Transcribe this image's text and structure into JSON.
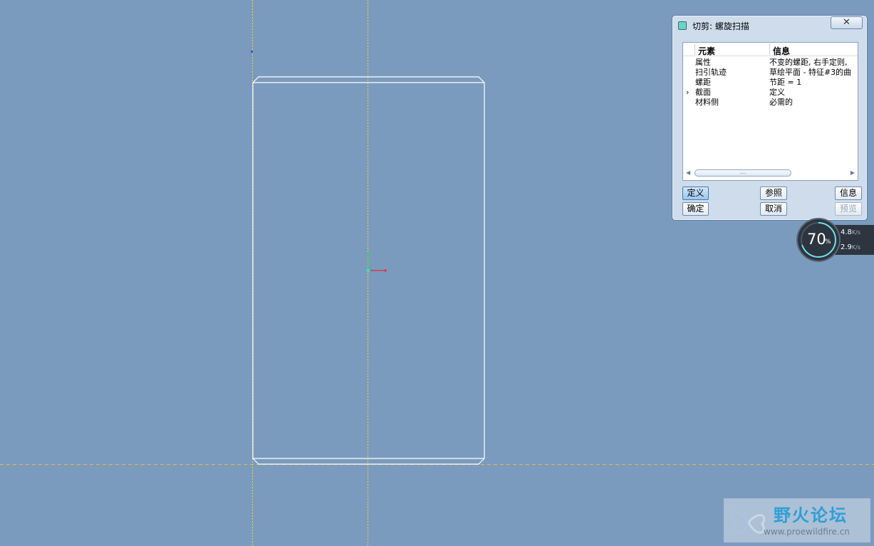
{
  "dialog": {
    "title": "切剪: 螺旋扫描",
    "close_glyph": "✕",
    "columns": [
      "元素",
      "信息"
    ],
    "rows": [
      {
        "element": "属性",
        "info": "不变的螺距, 右手定则,",
        "current": false
      },
      {
        "element": "扫引轨迹",
        "info": "草绘平面 - 特征#3的曲",
        "current": false
      },
      {
        "element": "螺距",
        "info": "节距 = 1",
        "current": false
      },
      {
        "element": "截面",
        "info": "定义",
        "current": true
      },
      {
        "element": "材料侧",
        "info": "必需的",
        "current": false
      }
    ],
    "current_marker": "›",
    "scroll_thumb_grip": "....",
    "buttons": {
      "define": "定义",
      "reference": "参照",
      "info": "信息",
      "ok": "确定",
      "cancel": "取消",
      "preview": "预览"
    }
  },
  "speed_widget": {
    "percent": "70",
    "percent_sign": "%",
    "upload_value": "4.8",
    "upload_unit": "K/s",
    "download_value": "2.9",
    "download_unit": "K/s",
    "gauge_fraction": 0.7,
    "colors": {
      "upload": "#28b7e8",
      "download": "#46d160",
      "gauge_arc": "#6fe0e6"
    }
  },
  "watermark": {
    "title": "野火论坛",
    "url": "www.proewildfire.cn"
  },
  "colors": {
    "background": "#7b9bbe",
    "datum_axis": "#f2d22c",
    "model_edges": "#ffffff",
    "csys_x": "#e03030",
    "csys_y": "#2fd74a"
  }
}
